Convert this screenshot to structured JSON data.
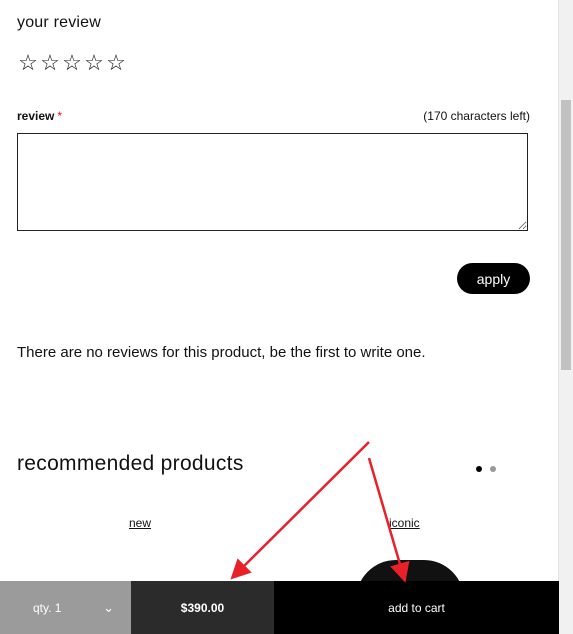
{
  "review": {
    "title": "your review",
    "stars": [
      "☆",
      "☆",
      "☆",
      "☆",
      "☆"
    ],
    "label": "review",
    "required_mark": "*",
    "chars_left": "(170 characters left)",
    "text_value": "",
    "apply_label": "apply"
  },
  "no_reviews_text": "There are no reviews for this product, be the first to write one.",
  "recommended": {
    "title": "recommended products",
    "tags": [
      "new",
      "iconic"
    ]
  },
  "bottom_bar": {
    "qty_label": "qty. 1",
    "qty_chevron": "⌄",
    "price": "$390.00",
    "add_to_cart": "add to cart"
  },
  "colors": {
    "annotation_arrow": "#e8202a",
    "required_mark": "#dd1111"
  }
}
